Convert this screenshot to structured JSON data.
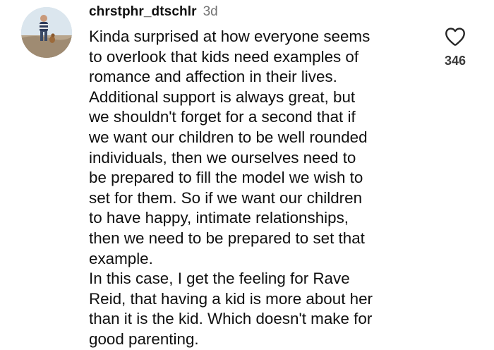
{
  "comment": {
    "username": "chrstphr_dtschlr",
    "timestamp": "3d",
    "like_count": "346",
    "avatar_icon": "profile-photo-icon",
    "like_icon": "heart-outline-icon",
    "text_lines": [
      "Kinda surprised at how everyone seems",
      "to overlook that kids need examples of",
      "romance and affection in their lives.",
      "Additional support is always great, but",
      "we shouldn't forget for a second that if",
      "we want our children to be well rounded",
      "individuals, then we ourselves need to",
      "be prepared to fill the model we wish to",
      "set for them. So if we want our children",
      "to have happy, intimate relationships,",
      "then we need to be prepared to set that",
      "example.",
      "In this case, I get the feeling for Rave",
      "Reid, that having a kid is more about her",
      "than it is the kid. Which doesn't make for",
      "good parenting."
    ]
  },
  "colors": {
    "text": "#0f0f0f",
    "muted": "#737373",
    "heart_stroke": "#262626"
  }
}
